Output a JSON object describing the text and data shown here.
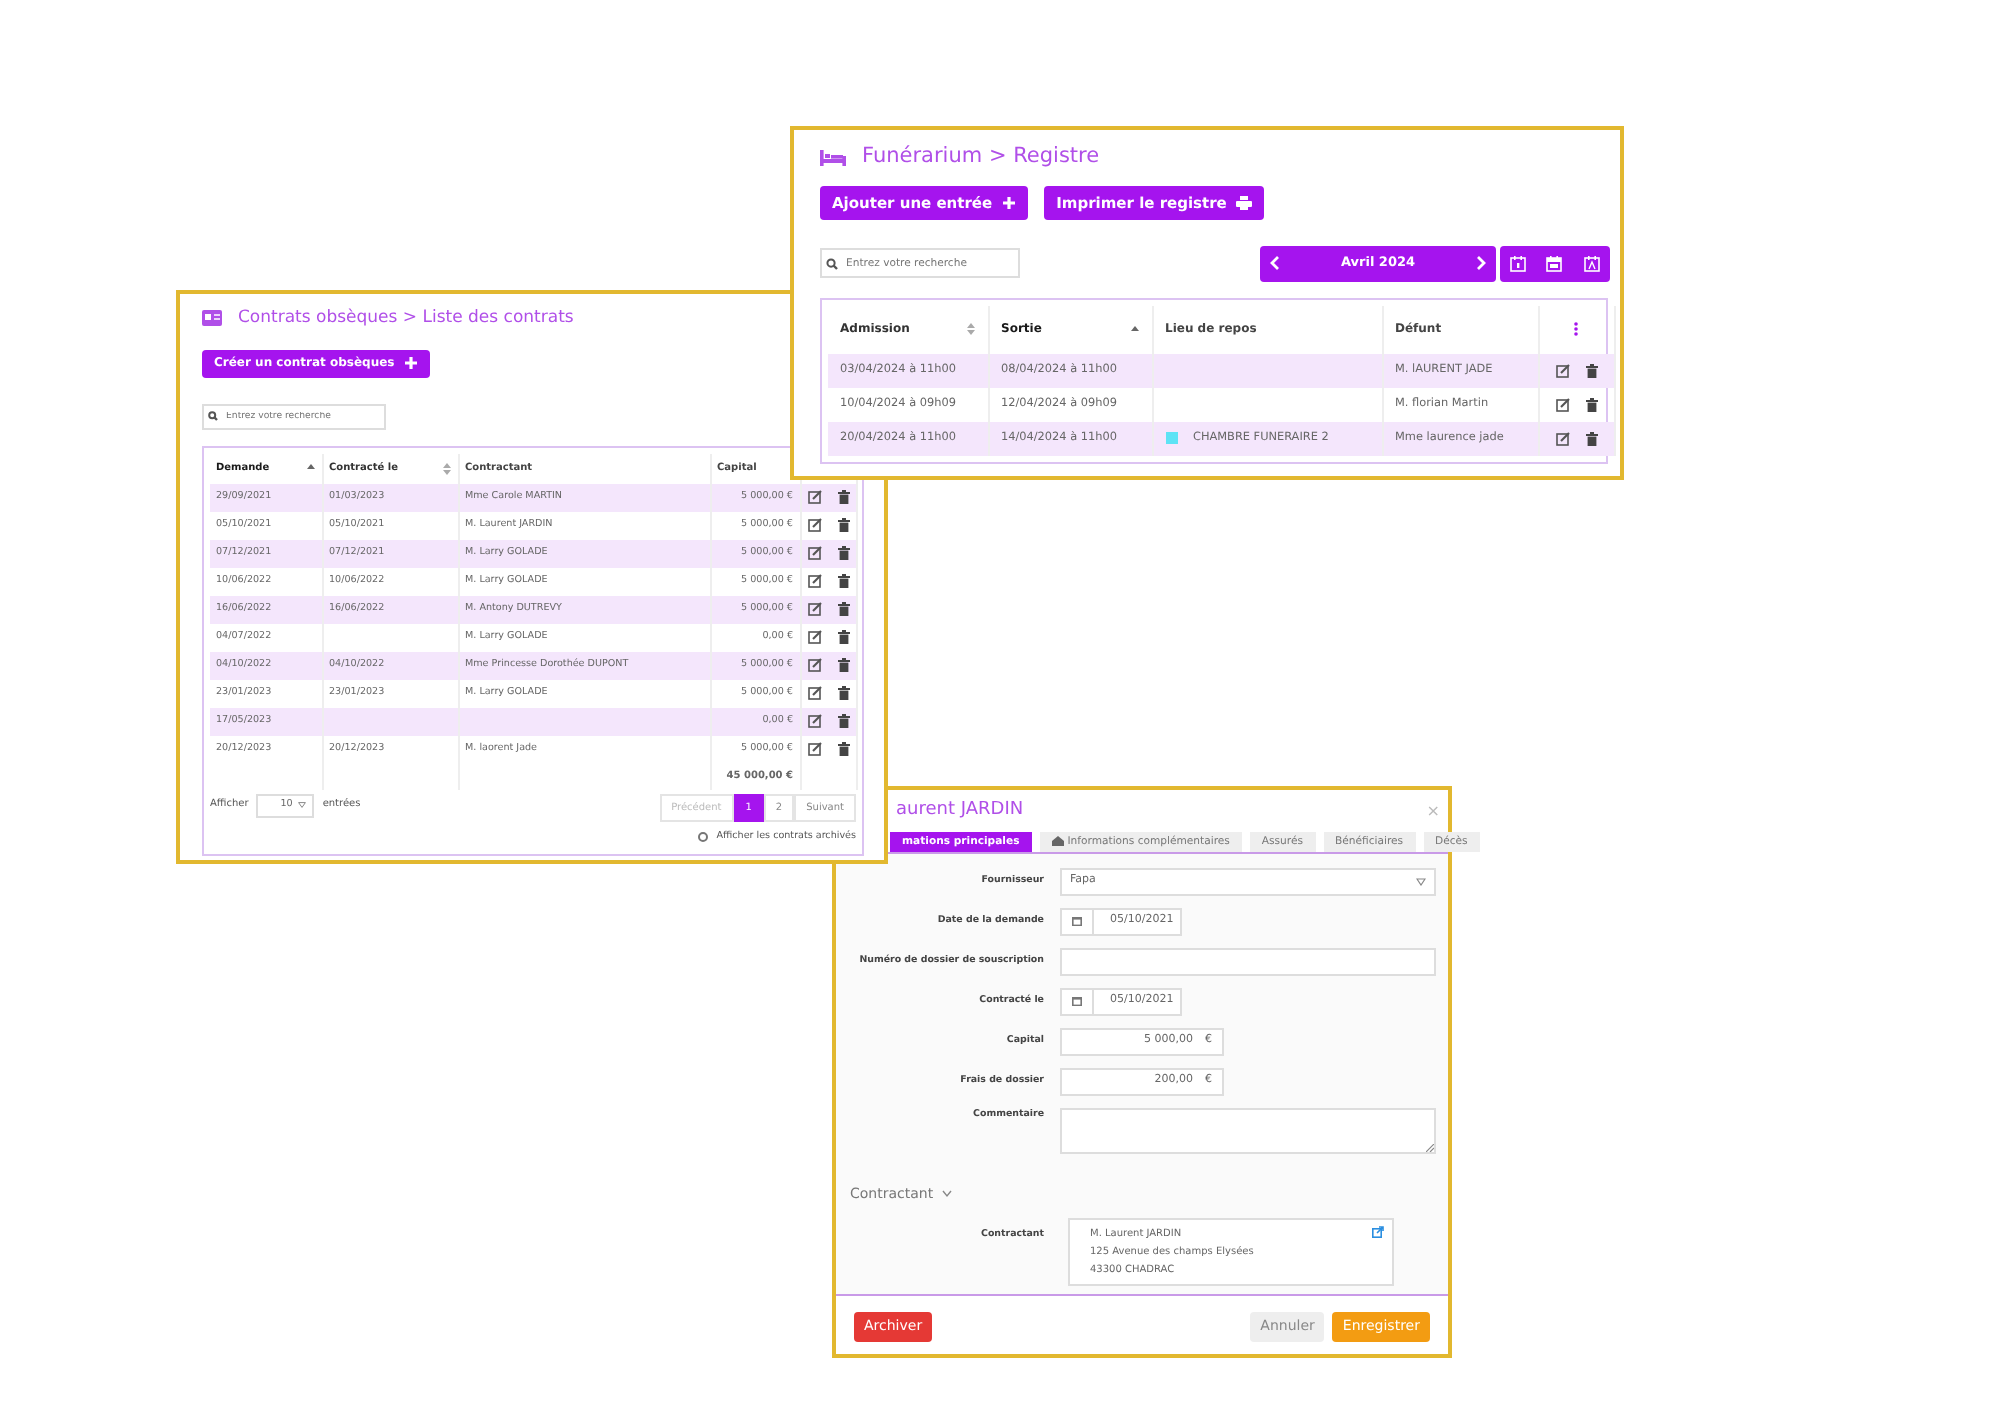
{
  "contract_form": {
    "title": "aurent JARDIN",
    "close": "×",
    "tabs": [
      {
        "label": "mations principales",
        "selected": true,
        "kind": "plain"
      },
      {
        "label": "Informations complémentaires",
        "selected": false,
        "kind": "icon"
      },
      {
        "label": "Assurés",
        "selected": false,
        "kind": "plain"
      },
      {
        "label": "Bénéficiaires",
        "selected": false,
        "kind": "plain"
      },
      {
        "label": "Décès",
        "selected": false,
        "kind": "plain"
      }
    ],
    "fields": [
      {
        "kind": "select",
        "label": "Fournisseur",
        "value": "Fapa"
      },
      {
        "kind": "date",
        "label": "Date de la demande",
        "value": "05/10/2021"
      },
      {
        "kind": "text",
        "label": "Numéro de dossier de souscription"
      },
      {
        "kind": "date",
        "label": "Contracté le",
        "value": "05/10/2021"
      },
      {
        "kind": "money",
        "label": "Capital",
        "value": "5 000,00",
        "unit": "€"
      },
      {
        "kind": "money",
        "label": "Frais de dossier",
        "value": "200,00",
        "unit": "€"
      },
      {
        "kind": "textarea",
        "label": "Commentaire"
      }
    ],
    "section": {
      "title": "Contractant",
      "expanded": true
    },
    "contractant": {
      "label": "Contractant",
      "lines": [
        "M. Laurent JARDIN",
        "125 Avenue des champs Elysées",
        "43300 CHADRAC"
      ]
    },
    "footer_buttons": [
      {
        "label": "Archiver",
        "kind": "danger"
      },
      {
        "label": "Annuler",
        "kind": "secondary"
      },
      {
        "label": "Enregistrer",
        "kind": "primary"
      }
    ]
  },
  "contracts_window": {
    "title": "Contrats obsèques > Liste des contrats",
    "button": "Créer un contrat obsèques",
    "search": {
      "placeholder": "Entrez votre recherche"
    },
    "columns": [
      {
        "label": "Demande",
        "sortable": true,
        "sorted": true
      },
      {
        "label": "Contracté le",
        "sortable": true,
        "sorted": false
      },
      {
        "label": "Contractant",
        "sortable": false,
        "sorted": false
      },
      {
        "label": "Capital",
        "sortable": false,
        "sorted": false
      }
    ],
    "rows": [
      {
        "demande": "29/09/2021",
        "contracte": "01/03/2023",
        "contractant": "Mme Carole MARTIN",
        "capital": "5 000,00 €"
      },
      {
        "demande": "05/10/2021",
        "contracte": "05/10/2021",
        "contractant": "M. Laurent JARDIN",
        "capital": "5 000,00 €"
      },
      {
        "demande": "07/12/2021",
        "contracte": "07/12/2021",
        "contractant": "M. Larry GOLADE",
        "capital": "5 000,00 €"
      },
      {
        "demande": "10/06/2022",
        "contracte": "10/06/2022",
        "contractant": "M. Larry GOLADE",
        "capital": "5 000,00 €"
      },
      {
        "demande": "16/06/2022",
        "contracte": "16/06/2022",
        "contractant": "M. Antony DUTREVY",
        "capital": "5 000,00 €"
      },
      {
        "demande": "04/07/2022",
        "contracte": "",
        "contractant": "M. Larry GOLADE",
        "capital": "0,00 €"
      },
      {
        "demande": "04/10/2022",
        "contracte": "04/10/2022",
        "contractant": "Mme Princesse Dorothée DUPONT",
        "capital": "5 000,00 €"
      },
      {
        "demande": "23/01/2023",
        "contracte": "23/01/2023",
        "contractant": "M. Larry GOLADE",
        "capital": "5 000,00 €"
      },
      {
        "demande": "17/05/2023",
        "contracte": "",
        "contractant": "",
        "capital": "0,00 €"
      },
      {
        "demande": "20/12/2023",
        "contracte": "20/12/2023",
        "contractant": "M. laorent Jade",
        "capital": "5 000,00 €"
      }
    ],
    "total": "45 000,00 €",
    "page_length": {
      "before": "Afficher",
      "value": "10",
      "after": "entrées"
    },
    "pagination": [
      {
        "label": "Précédent",
        "selected": false,
        "disabled": true
      },
      {
        "label": "1",
        "selected": true,
        "disabled": false
      },
      {
        "label": "2",
        "selected": false,
        "disabled": false
      },
      {
        "label": "Suivant",
        "selected": false,
        "disabled": false
      }
    ],
    "archived": {
      "label": "Afficher les contrats archivés",
      "checked": false
    }
  },
  "registre_window": {
    "title": "Funérarium > Registre",
    "buttons": [
      {
        "label": "Ajouter une entrée",
        "kind": "add"
      },
      {
        "label": "Imprimer le registre",
        "kind": "print"
      }
    ],
    "search": {
      "placeholder": "Entrez votre recherche"
    },
    "month": "Avril 2024",
    "columns": [
      {
        "label": "Admission",
        "sortable": true,
        "sorted": false
      },
      {
        "label": "Sortie",
        "sortable": true,
        "sorted": true
      },
      {
        "label": "Lieu de repos",
        "sortable": false,
        "sorted": false
      },
      {
        "label": "Défunt",
        "sortable": false,
        "sorted": false
      }
    ],
    "rows": [
      {
        "admission": "03/04/2024 à 11h00",
        "sortie": "08/04/2024 à 11h00",
        "lieu": "",
        "defunt": "M. lAURENT JADE"
      },
      {
        "admission": "10/04/2024 à 09h09",
        "sortie": "12/04/2024 à 09h09",
        "lieu": "",
        "defunt": "M. florian Martin"
      },
      {
        "admission": "20/04/2024 à 11h00",
        "sortie": "14/04/2024 à 11h00",
        "lieu": "CHAMBRE FUNERAIRE 2",
        "color": "#5de3f5",
        "defunt": "Mme laurence jade"
      }
    ]
  }
}
